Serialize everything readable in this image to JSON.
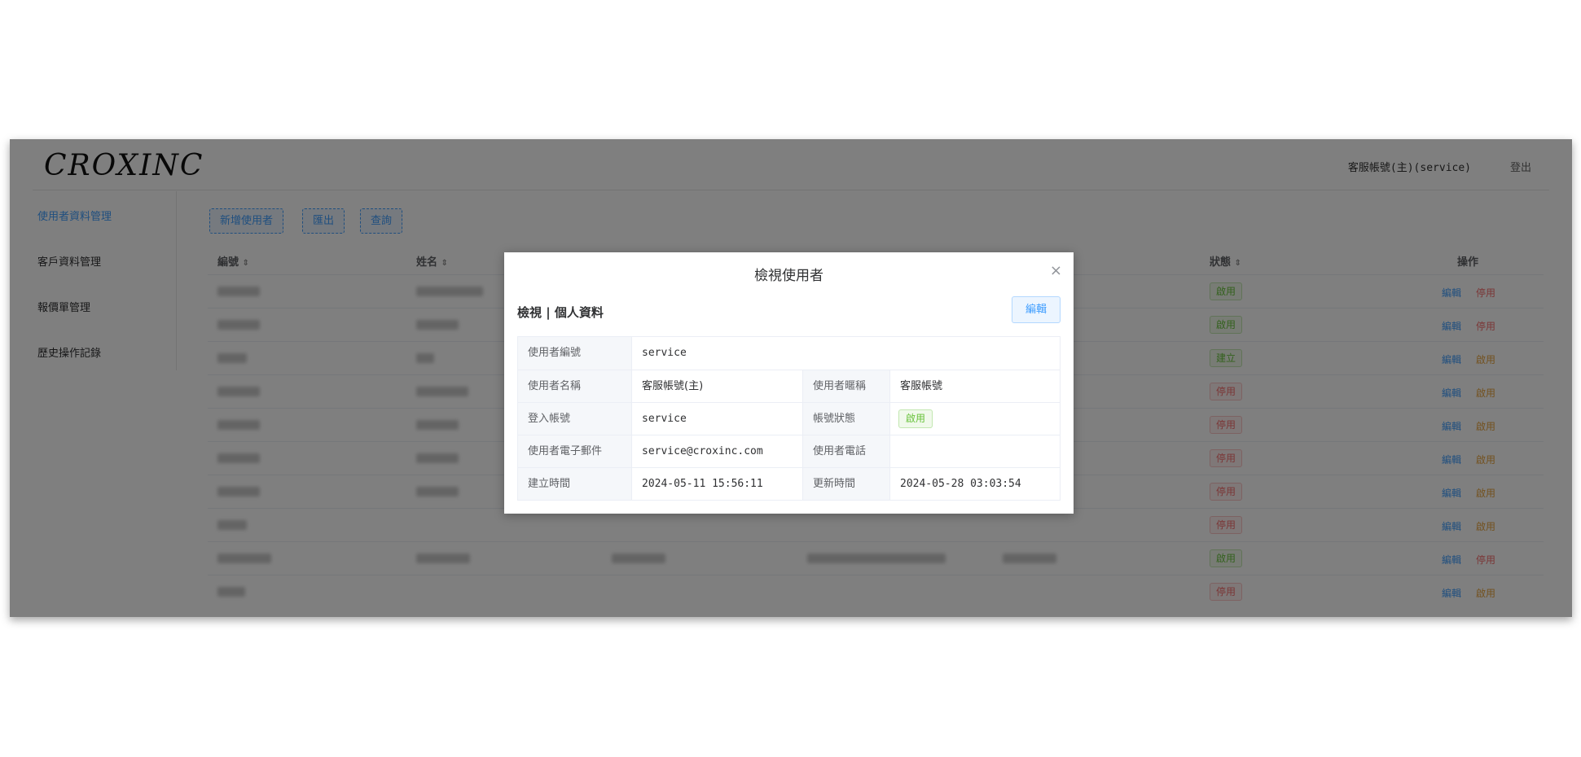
{
  "header": {
    "logo": "CROXINC",
    "user": "客服帳號(主)(service)",
    "logout": "登出"
  },
  "sidebar": {
    "items": [
      {
        "label": "使用者資料管理"
      },
      {
        "label": "客戶資料管理"
      },
      {
        "label": "報價單管理"
      },
      {
        "label": "歷史操作記錄"
      }
    ]
  },
  "toolbar": {
    "add_user": "新增使用者",
    "export": "匯出",
    "search": "查詢"
  },
  "table": {
    "headers": {
      "id": "編號",
      "name": "姓名",
      "status": "狀態",
      "actions": "操作"
    },
    "sort_glyph": "⇕",
    "edit_label": "編輯",
    "rows": [
      {
        "status": "啟用",
        "status_color": "green",
        "action2": "停用"
      },
      {
        "status": "啟用",
        "status_color": "green",
        "action2": "停用"
      },
      {
        "status": "建立",
        "status_color": "green",
        "action2": "啟用"
      },
      {
        "status": "停用",
        "status_color": "red",
        "action2": "啟用"
      },
      {
        "status": "停用",
        "status_color": "red",
        "action2": "啟用"
      },
      {
        "status": "停用",
        "status_color": "red",
        "action2": "啟用"
      },
      {
        "status": "停用",
        "status_color": "red",
        "action2": "啟用"
      },
      {
        "status": "停用",
        "status_color": "red",
        "action2": "啟用"
      },
      {
        "status": "啟用",
        "status_color": "green",
        "action2": "停用"
      },
      {
        "status": "停用",
        "status_color": "red",
        "action2": "啟用"
      }
    ]
  },
  "modal": {
    "title": "檢視使用者",
    "close": "×",
    "section_title": "檢視 | 個人資料",
    "edit_button": "編輯",
    "fields": {
      "user_id_label": "使用者編號",
      "user_id": "service",
      "user_name_label": "使用者名稱",
      "user_name": "客服帳號(主)",
      "nickname_label": "使用者暱稱",
      "nickname": "客服帳號",
      "login_label": "登入帳號",
      "login": "service",
      "account_status_label": "帳號狀態",
      "account_status": "啟用",
      "email_label": "使用者電子郵件",
      "email": "service@croxinc.com",
      "phone_label": "使用者電話",
      "phone": "",
      "created_label": "建立時間",
      "created": "2024-05-11 15:56:11",
      "updated_label": "更新時間",
      "updated": "2024-05-28 03:03:54"
    }
  },
  "colors": {
    "primary": "#409eff",
    "success": "#67c23a",
    "danger": "#f56c6c",
    "warning": "#e6a23c",
    "mask": "rgba(0,0,0,0.5)"
  }
}
